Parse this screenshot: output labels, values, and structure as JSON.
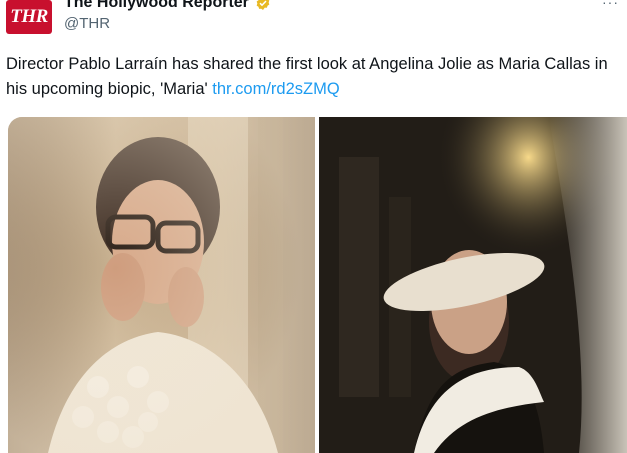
{
  "tweet": {
    "avatar_text": "THR",
    "display_name": "The Hollywood Reporter",
    "handle": "@THR",
    "more_label": "···",
    "text": "Director Pablo Larraín has shared the first look at Angelina Jolie as Maria Callas in his upcoming biopic, 'Maria' ",
    "link_text": "thr.com/rd2sZMQ",
    "media": [
      {
        "alt": ""
      },
      {
        "alt": ""
      }
    ]
  },
  "colors": {
    "brand": "#c8102e",
    "link": "#1d9bf0",
    "verified": "#e8b923",
    "muted": "#536471"
  },
  "icons": {
    "verified": "verified-badge-icon",
    "more": "more-options-icon"
  }
}
